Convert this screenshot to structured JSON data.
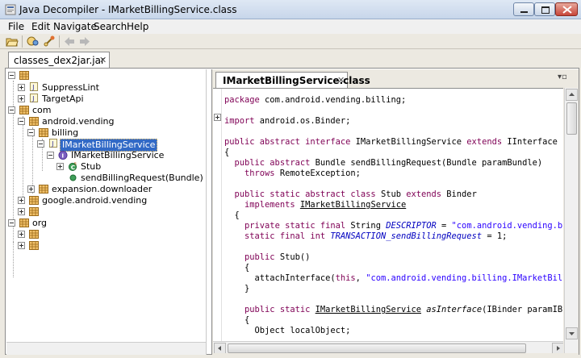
{
  "window": {
    "title": "Java Decompiler - IMarketBillingService.class"
  },
  "menu": [
    "File",
    "Edit",
    "Navigate",
    "Search",
    "Help"
  ],
  "toolbar": {
    "icons": [
      "open-folder-icon",
      "open-type-icon",
      "open-type-hierarchy-icon",
      "back-icon",
      "forward-icon"
    ]
  },
  "file_tab": {
    "label": "classes_dex2jar.jar",
    "close": "✕"
  },
  "tree": [
    {
      "label": "",
      "kind": "package"
    },
    {
      "label": "SuppressLint",
      "kind": "class-file"
    },
    {
      "label": "TargetApi",
      "kind": "class-file"
    },
    {
      "label": "com",
      "kind": "package"
    },
    {
      "label": "android.vending",
      "kind": "package"
    },
    {
      "label": "billing",
      "kind": "package"
    },
    {
      "label": "IMarketBillingService",
      "kind": "class-file"
    },
    {
      "label": "IMarketBillingService",
      "kind": "interface"
    },
    {
      "label": "Stub",
      "kind": "class"
    },
    {
      "label": "sendBillingRequest(Bundle) : I",
      "kind": "method"
    },
    {
      "label": "expansion.downloader",
      "kind": "package"
    },
    {
      "label": "google.android.vending",
      "kind": "package"
    },
    {
      "label": "",
      "kind": "package"
    },
    {
      "label": "org",
      "kind": "package"
    },
    {
      "label": "",
      "kind": "package"
    },
    {
      "label": "",
      "kind": "package"
    }
  ],
  "editor": {
    "tab_label": "IMarketBillingService.class",
    "tab_close": "✕",
    "menu_glyph": "▾▫",
    "lines": [
      "package com.android.vending.billing;",
      "",
      "import android.os.Binder;",
      "",
      "public abstract interface IMarketBillingService extends IInterface",
      "{",
      "  public abstract Bundle sendBillingRequest(Bundle paramBundle)",
      "    throws RemoteException;",
      "",
      "  public static abstract class Stub extends Binder",
      "    implements IMarketBillingService",
      "  {",
      "    private static final String DESCRIPTOR = \"com.android.vending.billing",
      "    static final int TRANSACTION_sendBillingRequest = 1;",
      "",
      "    public Stub()",
      "    {",
      "      attachInterface(this, \"com.android.vending.billing.IMarketBillingSe",
      "    }",
      "",
      "    public static IMarketBillingService asInterface(IBinder paramIBinder)",
      "    {",
      "      Object localObject;"
    ]
  },
  "colors": {
    "keyword": "#7f0055",
    "string": "#2a00ff",
    "field": "#0000c0",
    "selection": "#3169c6"
  }
}
